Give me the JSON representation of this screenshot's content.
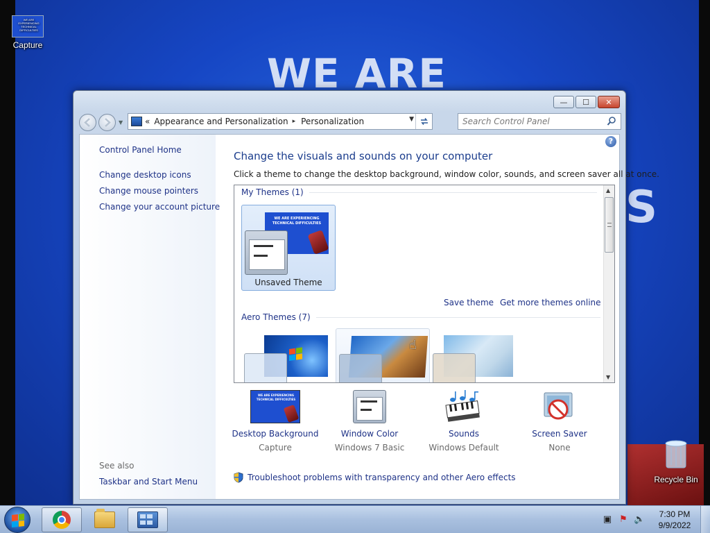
{
  "desktop": {
    "wallpaper_headline": "WE ARE",
    "wallpaper_fragment": "S",
    "icons": {
      "capture": "Capture",
      "capture_thumb_text": "WE ARE EXPERIENCING TECHNICAL DIFFICULTIES",
      "recycle_bin": "Recycle Bin"
    }
  },
  "window": {
    "caption_buttons": {
      "minimize": "—",
      "maximize": "☐",
      "close": "✕"
    },
    "address": {
      "chevrons": "«",
      "crumbs": [
        "Appearance and Personalization",
        "Personalization"
      ],
      "separator": "▸"
    },
    "search": {
      "placeholder": "Search Control Panel"
    },
    "sidebar": {
      "home": "Control Panel Home",
      "links": [
        "Change desktop icons",
        "Change mouse pointers",
        "Change your account picture"
      ],
      "see_also_heading": "See also",
      "see_also_links": [
        "Taskbar and Start Menu"
      ]
    },
    "main": {
      "title": "Change the visuals and sounds on your computer",
      "subtitle": "Click a theme to change the desktop background, window color, sounds, and screen saver all at once.",
      "my_themes_header": "My Themes (1)",
      "unsaved_theme": {
        "name": "Unsaved Theme",
        "preview_text": "WE ARE EXPERIENCING TECHNICAL DIFFICULTIES"
      },
      "save_theme": "Save theme",
      "get_more_themes": "Get more themes online",
      "aero_themes_header": "Aero Themes (7)",
      "settings": [
        {
          "label": "Desktop Background",
          "value": "Capture",
          "icon": "desktop-background-icon",
          "thumb_text": "WE ARE EXPERIENCING TECHNICAL DIFFICULTIES"
        },
        {
          "label": "Window Color",
          "value": "Windows 7 Basic",
          "icon": "window-color-icon"
        },
        {
          "label": "Sounds",
          "value": "Windows Default",
          "icon": "sounds-icon"
        },
        {
          "label": "Screen Saver",
          "value": "None",
          "icon": "screen-saver-icon"
        }
      ],
      "troubleshoot": "Troubleshoot problems with transparency and other Aero effects"
    }
  },
  "taskbar": {
    "pinned": [
      "chrome-icon",
      "windows-explorer-icon",
      "control-panel-icon"
    ],
    "tray": {
      "time": "7:30 PM",
      "date": "9/9/2022"
    }
  },
  "colors": {
    "link": "#1e3287",
    "title": "#1a3c8c",
    "wallpaper_blue": "#1646c4"
  }
}
